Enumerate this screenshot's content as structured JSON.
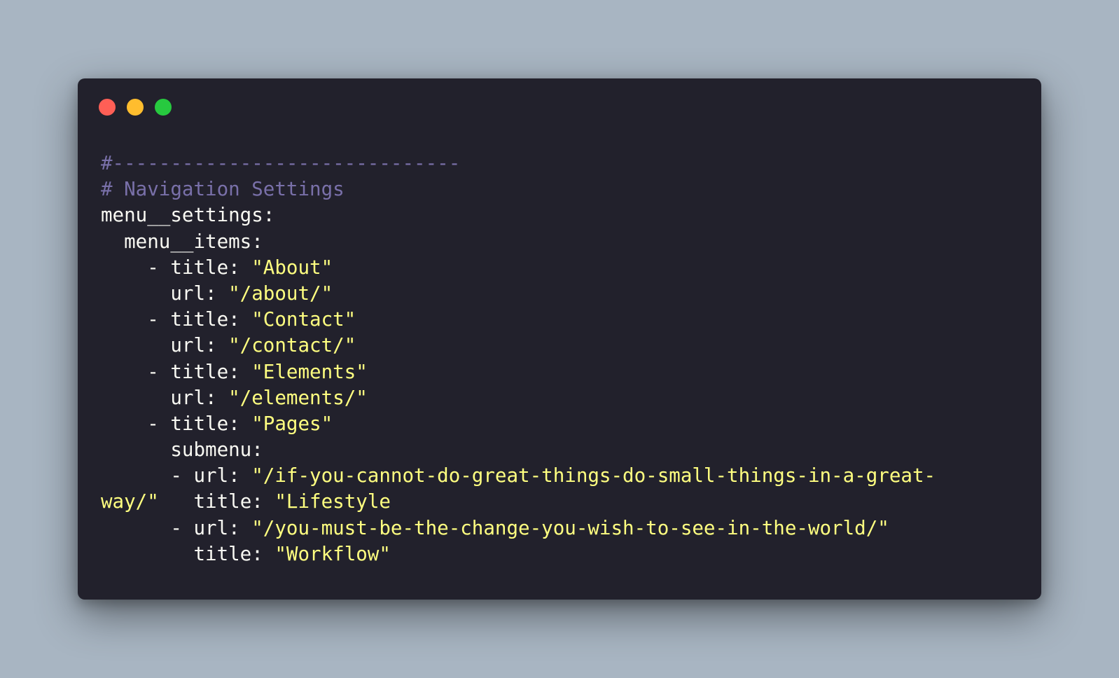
{
  "window": {
    "colors": {
      "background": "#22212c",
      "close": "#ff5f56",
      "minimize": "#ffbd2e",
      "maximize": "#27c93f",
      "comment": "#7970a9",
      "string": "#ffff80",
      "text": "#f8f8f2"
    }
  },
  "code": {
    "lines": [
      {
        "comment": "#------------------------------"
      },
      {
        "comment": "# Navigation Settings"
      },
      {
        "plain": "menu__settings:"
      },
      {
        "plain": "  menu__items:"
      },
      {
        "plain": "    - title: ",
        "str": "\"About\""
      },
      {
        "plain": "      url: ",
        "str": "\"/about/\""
      },
      {
        "plain": "    - title: ",
        "str": "\"Contact\""
      },
      {
        "plain": "      url: ",
        "str": "\"/contact/\""
      },
      {
        "plain": "    - title: ",
        "str": "\"Elements\""
      },
      {
        "plain": "      url: ",
        "str": "\"/elements/\""
      },
      {
        "plain": "    - title: ",
        "str": "\"Pages\""
      },
      {
        "plain": "      submenu:"
      },
      {
        "plain": "      - url: ",
        "str": "\"/if-you-cannot-do-great-things-do-small-things-in-a-great-"
      },
      {
        "str": "way/\"",
        "plain": "   title: ",
        "str2": "\"Lifestyle"
      },
      {
        "plain": "      - url: ",
        "str": "\"/you-must-be-the-change-you-wish-to-see-in-the-world/\""
      },
      {
        "plain": "        title: ",
        "str": "\"Workflow\""
      }
    ]
  }
}
